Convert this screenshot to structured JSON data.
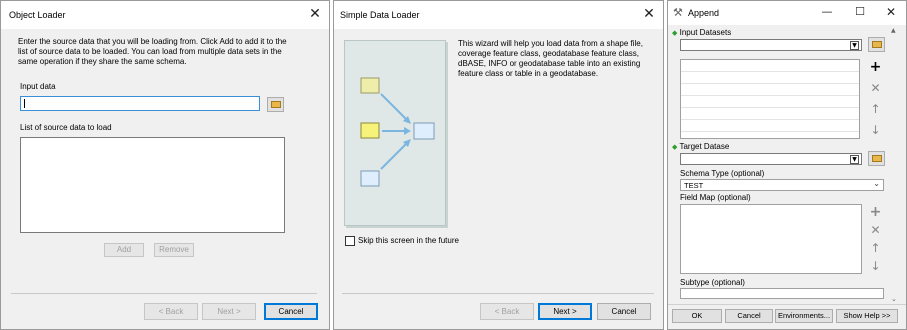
{
  "object_loader": {
    "title": "Object Loader",
    "intro": "Enter the source data that you will be loading from. Click Add to add it to the list of source data to be loaded. You can load from multiple data sets in the same operation if they share the same schema.",
    "input_label": "Input data",
    "input_value": "",
    "list_label": "List of source data to load",
    "add_label": "Add",
    "remove_label": "Remove",
    "back_label": "< Back",
    "next_label": "Next >",
    "cancel_label": "Cancel"
  },
  "simple_loader": {
    "title": "Simple Data Loader",
    "description": "This wizard will help you load data from a shape file, coverage feature class, geodatabase feature class, dBASE, INFO or geodatabase table into an existing feature class or table in a geodatabase.",
    "skip_label": "Skip this screen in the future",
    "back_label": "< Back",
    "next_label": "Next >",
    "cancel_label": "Cancel",
    "colors": {
      "panel": "#dfe8e6",
      "box_yellow_light": "#eeeeaa",
      "box_yellow": "#f7f37a",
      "box_blue": "#dfeefc",
      "arrow": "#7ab6e0"
    }
  },
  "append": {
    "title": "Append",
    "input_datasets_label": "Input Datasets",
    "target_dataset_label": "Target Datase",
    "schema_type_label": "Schema Type (optional)",
    "schema_type_value": "TEST",
    "field_map_label": "Field Map (optional)",
    "subtype_label": "Subtype (optional)",
    "ok_label": "OK",
    "cancel_label": "Cancel",
    "environments_label": "Environments...",
    "show_help_label": "Show Help >>",
    "icons": [
      "hammer-icon",
      "minimize-icon",
      "maximize-icon",
      "close-icon",
      "add-icon",
      "delete-icon",
      "move-up-icon",
      "move-down-icon"
    ]
  }
}
